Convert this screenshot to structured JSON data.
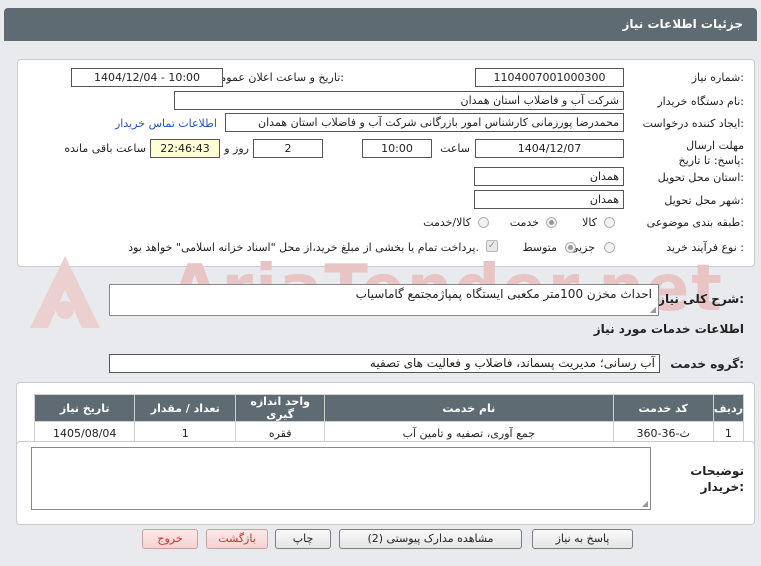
{
  "window": {
    "title": "جزئیات اطلاعات نیاز"
  },
  "watermark": {
    "text": "AriaTender.net"
  },
  "fields": {
    "need_number_label": "شماره نیاز:",
    "need_number": "1104007001000300",
    "announce_label": "تاریخ و ساعت اعلان عمومی:",
    "announce_value": "1404/12/04 - 10:00",
    "buyer_label": "نام دستگاه خریدار:",
    "buyer_value": "شرکت آب و فاضلاب استان همدان",
    "creator_label": "ایجاد کننده درخواست:",
    "creator_value": "محمدرضا پورزمانی کارشناس امور بازرگانی شرکت آب و فاضلاب استان همدان",
    "contact_link": "اطلاعات تماس خریدار",
    "deadline_label": "مهلت ارسال پاسخ: تا تاریخ:",
    "deadline_date": "1404/12/07",
    "time_label": "ساعت",
    "deadline_time": "10:00",
    "days_value": "2",
    "days_label": "روز و",
    "remaining_time": "22:46:43",
    "remaining_label": "ساعت باقی مانده",
    "province_label": "استان محل تحویل:",
    "province_value": "همدان",
    "city_label": "شهر محل تحویل:",
    "city_value": "همدان",
    "category_label": "طبقه بندی موضوعی:",
    "category_options": [
      "کالا",
      "خدمت",
      "کالا/خدمت"
    ],
    "category_selected": "خدمت",
    "process_label": "نوع فرآیند خرید :",
    "process_options": [
      "جزیی",
      "متوسط"
    ],
    "process_selected": "متوسط",
    "payment_note": "پرداخت تمام یا بخشی از مبلغ خرید،از محل \"اسناد خزانه اسلامی\" خواهد بود."
  },
  "summary": {
    "label": "شرح کلی نیاز:",
    "value": "احداث مخزن 100متر مکعبی ایستگاه پمپاژمجتمع گاماسیاب"
  },
  "services": {
    "section_title": "اطلاعات خدمات مورد نیاز",
    "group_label": "گروه خدمت:",
    "group_value": "آب رسانی؛ مدیریت پسماند، فاضلاب و فعالیت های تصفیه",
    "columns": [
      "ردیف",
      "کد خدمت",
      "نام خدمت",
      "واحد اندازه گیری",
      "تعداد / مقدار",
      "تاریخ نیاز"
    ],
    "rows": [
      {
        "index": "1",
        "code": "ث-36-360",
        "name": "جمع آوری، تصفیه و تامین آب",
        "unit": "فقره",
        "qty": "1",
        "date": "1405/08/04"
      }
    ]
  },
  "notes": {
    "label": "توضیحات خریدار:",
    "value": ""
  },
  "buttons": {
    "respond": "پاسخ به نیاز",
    "attachments": "مشاهده مدارک پیوستی (2)",
    "print": "چاپ",
    "back": "بازگشت",
    "exit": "خروج"
  }
}
